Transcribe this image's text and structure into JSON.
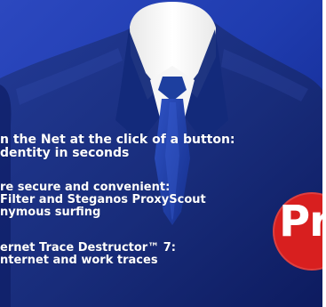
{
  "headline_blocks": [
    {
      "lines": [
        "n the Net at the click of a button:",
        "dentity in seconds"
      ]
    },
    {
      "lines": [
        "re secure and convenient:",
        "Filter and Steganos ProxyScout",
        "nymous surfing"
      ]
    },
    {
      "lines": [
        "ernet Trace Destructor™ 7:",
        "nternet and work traces"
      ]
    }
  ],
  "badge": {
    "text": "Pr"
  },
  "colors": {
    "background": "#1a36a8",
    "suit": "#1b2f86",
    "suit_dark": "#0b155a",
    "shirt": "#f7f7f7",
    "tie": "#183b9d",
    "badge": "#d81f1f",
    "text": "#ffffff"
  }
}
